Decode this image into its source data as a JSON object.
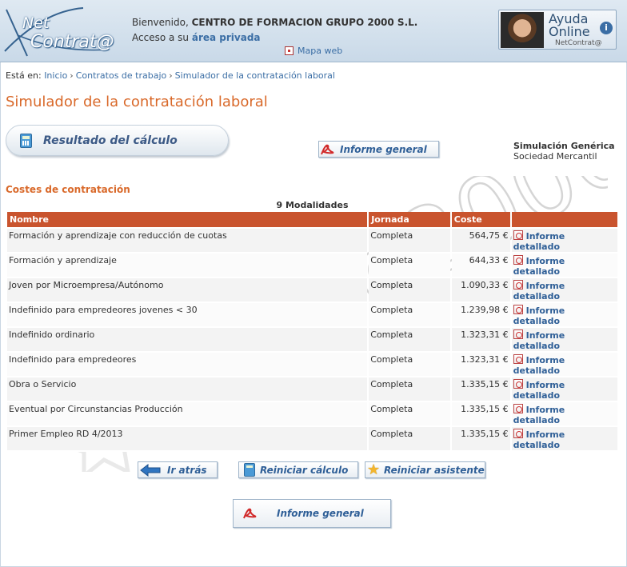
{
  "header": {
    "logo_net": "Net",
    "logo_contrata": "Contrat@",
    "welcome_prefix": "Bienvenido,",
    "company": "CENTRO DE FORMACION GRUPO 2000 S.L.",
    "access_prefix": "Acceso a su",
    "access_link": "área privada",
    "mapa_web": "Mapa web",
    "help_line1": "Ayuda",
    "help_line2": "Online",
    "help_brand": "NetContrat@",
    "help_icon": "i"
  },
  "breadcrumb": {
    "prefix": "Está en:",
    "items": [
      "Inicio",
      "Contratos de trabajo",
      "Simulador de la contratación laboral"
    ]
  },
  "page_title": "Simulador de la contratación laboral",
  "result_label": "Resultado del cálculo",
  "informe_general": "Informe general",
  "simulation": {
    "title": "Simulación Genérica",
    "subtitle": "Sociedad Mercantil"
  },
  "section_title": "Costes de contratación",
  "modalidades": "9 Modalidades",
  "table": {
    "headers": [
      "Nombre",
      "Jornada",
      "Coste",
      ""
    ],
    "link_line1": "Informe",
    "link_line2": "detallado",
    "rows": [
      {
        "nombre": "Formación y aprendizaje con reducción de cuotas",
        "jornada": "Completa",
        "coste": "564,75 €"
      },
      {
        "nombre": "Formación y aprendizaje",
        "jornada": "Completa",
        "coste": "644,33 €"
      },
      {
        "nombre": "Joven por Microempresa/Autónomo",
        "jornada": "Completa",
        "coste": "1.090,33 €"
      },
      {
        "nombre": "Indefinido para empredeores jovenes < 30",
        "jornada": "Completa",
        "coste": "1.239,98 €"
      },
      {
        "nombre": "Indefinido ordinario",
        "jornada": "Completa",
        "coste": "1.323,31 €"
      },
      {
        "nombre": "Indefinido para empredeores",
        "jornada": "Completa",
        "coste": "1.323,31 €"
      },
      {
        "nombre": "Obra o Servicio",
        "jornada": "Completa",
        "coste": "1.335,15 €"
      },
      {
        "nombre": "Eventual por Circunstancias Producción",
        "jornada": "Completa",
        "coste": "1.335,15 €"
      },
      {
        "nombre": "Primer Empleo RD 4/2013",
        "jornada": "Completa",
        "coste": "1.335,15 €"
      }
    ]
  },
  "buttons": {
    "atras": "Ir atrás",
    "reiniciar": "Reiniciar cálculo",
    "asistente": "Reiniciar asistente",
    "informe_bottom": "Informe general"
  },
  "watermark": "grupo2000",
  "icons": {
    "pdf": "pdf-icon",
    "calculator": "calculator-icon",
    "arrow_back": "arrow-left-icon",
    "star": "star-icon",
    "sitemap": "sitemap-icon",
    "help_agent": "help-agent-avatar"
  },
  "colors": {
    "accent_orange": "#d9692a",
    "table_header": "#c9542e",
    "link_blue": "#2f5f97"
  }
}
